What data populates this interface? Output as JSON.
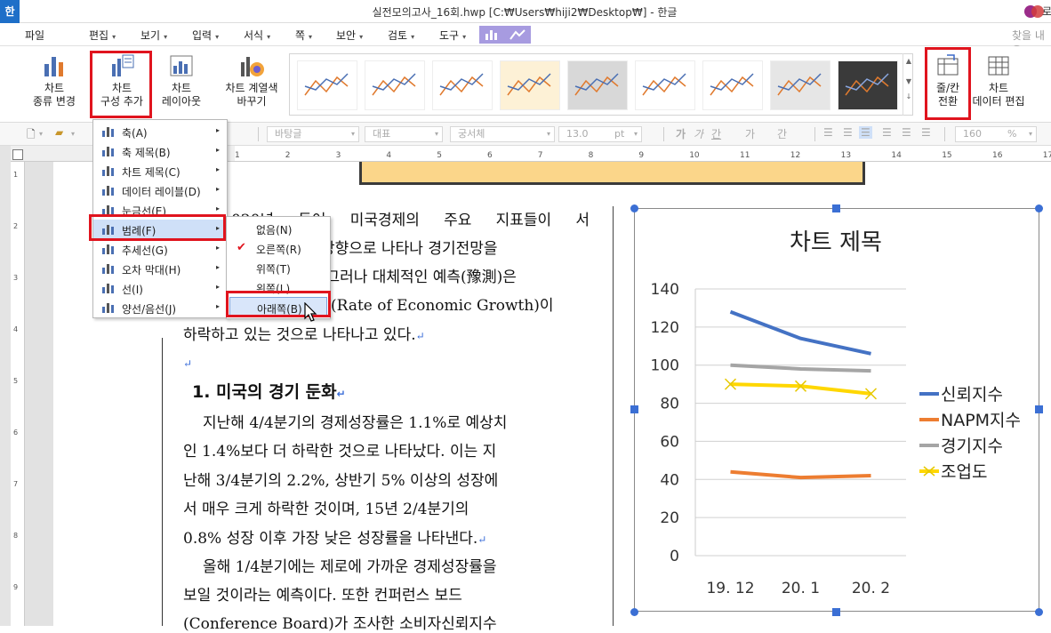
{
  "titlebar": {
    "app_logo": "한",
    "title": "실전모의고사_16회.hwp [C:₩Users₩hiji2₩Desktop₩] - 한글",
    "profile": "로"
  },
  "menu": {
    "items": [
      "파일",
      "편집",
      "보기",
      "입력",
      "서식",
      "쪽",
      "보안",
      "검토",
      "도구"
    ],
    "help_right": "찾을 내용"
  },
  "ribbon": {
    "chart_type": "차트\n종류 변경",
    "chart_add": "차트\n구성 추가",
    "chart_layout": "차트\n레이아웃",
    "chart_color": "차트 계열색\n바꾸기",
    "row_col": "줄/칸\n전환",
    "data_edit": "차트\n데이터 편집"
  },
  "toolbar2": {
    "style": "바탕글",
    "para_style": "대표",
    "font": "궁서체",
    "size": "13.0",
    "unit": "pt",
    "zoom": "160",
    "zoom_unit": "%",
    "format_glyphs": [
      "가",
      "가",
      "간",
      "가",
      "간"
    ]
  },
  "ruler": {
    "numbers": [
      "1",
      "2",
      "3",
      "4",
      "5",
      "6",
      "7",
      "8",
      "9",
      "10",
      "11",
      "12",
      "13",
      "14",
      "15",
      "16",
      "17"
    ]
  },
  "document": {
    "lines": [
      "020년  들어  미국경제의  주요  지표들이  서",
      "는  방향으로  나타나  경기전망을",
      "다.  그러나  대체적인  예측(豫測)은",
      "(Rate  of  Economic  Growth)이",
      "하락하고  있는  것으로  나타나고  있다.",
      "",
      "지난해  4/4분기의  경제성장률은  1.1%로  예상치",
      "인  1.4%보다  더  하락한  것으로  나타났다.  이는  지",
      "난해  3/4분기의  2.2%,  상반기  5%  이상의  성장에",
      "서  매우  크게  하락한  것이며,  15년  2/4분기의",
      "0.8%  성장  이후  가장  낮은  성장률을  나타낸다.",
      "올해  1/4분기에는  제로에  가까운  경제성장률을",
      "보일  것이라는  예측이다.  또한  컨퍼런스  보드",
      "(Conference  Board)가  조사한  소비자신뢰지수"
    ],
    "heading": "1.  미국의  경기  둔화",
    "para_mark": "↵",
    "empty_mark": "↵"
  },
  "dropdown": {
    "items": [
      "축(A)",
      "축 제목(B)",
      "차트 제목(C)",
      "데이터 레이블(D)",
      "눈금선(E)",
      "범례(F)",
      "추세선(G)",
      "오차 막대(H)",
      "선(I)",
      "양선/음선(J)"
    ],
    "active_index": 5
  },
  "submenu": {
    "items": [
      "없음(N)",
      "오른쪽(R)",
      "위쪽(T)",
      "왼쪽(L)",
      "아래쪽(B)"
    ],
    "checked_index": 1,
    "hover_index": 4
  },
  "chart_data": {
    "type": "line",
    "title": "차트 제목",
    "categories": [
      "19. 12",
      "20. 1",
      "20. 2"
    ],
    "ylim": [
      0,
      140
    ],
    "yticks": [
      "0",
      "20",
      "40",
      "60",
      "80",
      "100",
      "120",
      "140"
    ],
    "legend_position": "right",
    "grid": true,
    "series": [
      {
        "name": "신뢰지수",
        "values": [
          128,
          114,
          106
        ],
        "color": "#4472c4"
      },
      {
        "name": "NAPM지수",
        "values": [
          44,
          41,
          42
        ],
        "color": "#ed7d31"
      },
      {
        "name": "경기지수",
        "values": [
          100,
          98,
          97
        ],
        "color": "#a5a5a5"
      },
      {
        "name": "조업도",
        "values": [
          90,
          89,
          85
        ],
        "color": "#ffd700"
      }
    ]
  },
  "colors": {
    "accent_red": "#e0141e",
    "chart_context": "#a79be0",
    "selection": "#3b6fd4"
  }
}
